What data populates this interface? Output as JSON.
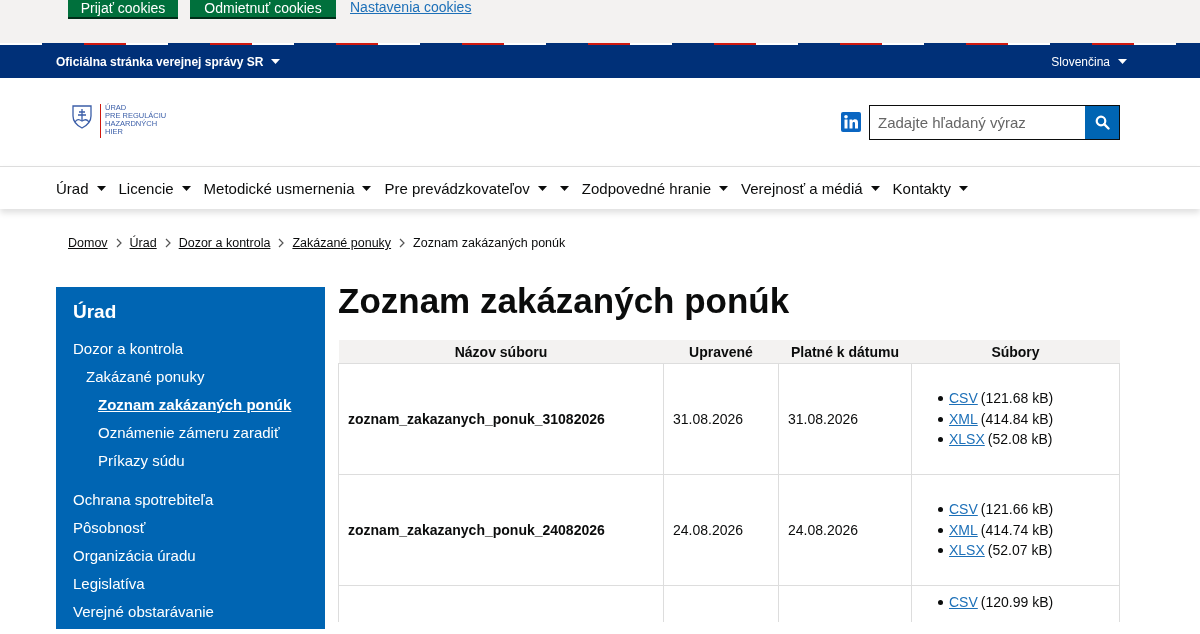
{
  "cookie_bar": {
    "buttons": [
      "Prijať cookies",
      "Odmietnuť cookies"
    ],
    "link": "Nastavenia cookies"
  },
  "gov_bar": {
    "label": "Oficiálna stránka verejnej správy SR",
    "language": "Slovenčina"
  },
  "header": {
    "logo_lines": [
      "ÚRAD",
      "PRE REGULÁCIU",
      "HAZARDNÝCH",
      "HIER"
    ],
    "search": {
      "placeholder": "Zadajte hľadaný výraz"
    }
  },
  "nav": [
    {
      "kind": "menu",
      "label": "Úrad"
    },
    {
      "kind": "menu",
      "label": "Licencie"
    },
    {
      "kind": "menu",
      "label": "Metodické usmernenia"
    },
    {
      "kind": "menu",
      "label": "Pre prevádzkovateľov"
    },
    {
      "kind": "toggle"
    },
    {
      "kind": "menu",
      "label": "Zodpovedné hranie"
    },
    {
      "kind": "menu",
      "label": "Verejnosť a médiá"
    },
    {
      "kind": "menu",
      "label": "Kontakty"
    }
  ],
  "breadcrumb": [
    {
      "label": "Domov",
      "link": true
    },
    {
      "label": "Úrad",
      "link": true
    },
    {
      "label": "Dozor a kontrola",
      "link": true
    },
    {
      "label": "Zakázané ponuky",
      "link": true
    },
    {
      "label": "Zoznam zakázaných ponúk",
      "link": false
    }
  ],
  "sidebar": {
    "title": "Úrad",
    "items": [
      {
        "label": "Dozor a kontrola",
        "selected": false,
        "children": [
          {
            "label": "Zakázané ponuky",
            "selected": false,
            "children": [
              {
                "label": "Zoznam zakázaných ponúk",
                "selected": true
              },
              {
                "label": "Oznámenie zámeru zaradiť",
                "selected": false
              },
              {
                "label": "Príkazy súdu",
                "selected": false
              }
            ]
          }
        ]
      },
      {
        "label": "Ochrana spotrebiteľa",
        "selected": false
      },
      {
        "label": "Pôsobnosť",
        "selected": false
      },
      {
        "label": "Organizácia úradu",
        "selected": false
      },
      {
        "label": "Legislatíva",
        "selected": false
      },
      {
        "label": "Verejné obstarávanie",
        "selected": false
      }
    ]
  },
  "page_title": "Zoznam zakázaných ponúk",
  "table": {
    "columns": [
      "Názov súboru",
      "Upravené",
      "Platné k dátumu",
      "Súbory"
    ],
    "rows": [
      {
        "name": "zoznam_zakazanych_ponuk_31082026",
        "modified": "31.08.2026",
        "valid": "31.08.2026",
        "files": [
          {
            "format": "CSV",
            "size": "(121.68 kB)"
          },
          {
            "format": "XML",
            "size": "(414.84 kB)"
          },
          {
            "format": "XLSX",
            "size": "(52.08 kB)"
          }
        ]
      },
      {
        "name": "zoznam_zakazanych_ponuk_24082026",
        "modified": "24.08.2026",
        "valid": "24.08.2026",
        "files": [
          {
            "format": "CSV",
            "size": "(121.66 kB)"
          },
          {
            "format": "XML",
            "size": "(414.74 kB)"
          },
          {
            "format": "XLSX",
            "size": "(52.07 kB)"
          }
        ]
      },
      {
        "files": [
          {
            "format": "CSV",
            "size": "(120.99 kB)"
          }
        ]
      }
    ]
  }
}
